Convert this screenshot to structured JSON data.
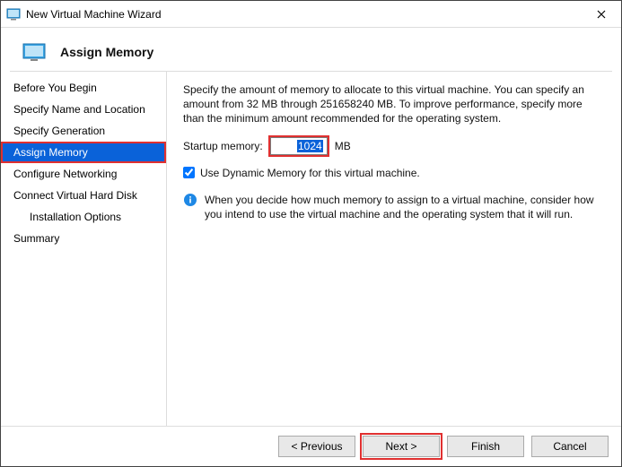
{
  "window": {
    "title": "New Virtual Machine Wizard"
  },
  "header": {
    "heading": "Assign Memory"
  },
  "sidebar": {
    "items": [
      {
        "label": "Before You Begin"
      },
      {
        "label": "Specify Name and Location"
      },
      {
        "label": "Specify Generation"
      },
      {
        "label": "Assign Memory",
        "selected": true,
        "highlight": true
      },
      {
        "label": "Configure Networking"
      },
      {
        "label": "Connect Virtual Hard Disk"
      },
      {
        "label": "Installation Options",
        "indent": true
      },
      {
        "label": "Summary"
      }
    ]
  },
  "content": {
    "description": "Specify the amount of memory to allocate to this virtual machine. You can specify an amount from 32 MB through 251658240 MB. To improve performance, specify more than the minimum amount recommended for the operating system.",
    "memory_label": "Startup memory:",
    "memory_value": "1024",
    "memory_unit": "MB",
    "dynamic_memory_label": "Use Dynamic Memory for this virtual machine.",
    "dynamic_memory_checked": true,
    "info_text": "When you decide how much memory to assign to a virtual machine, consider how you intend to use the virtual machine and the operating system that it will run."
  },
  "footer": {
    "previous": "< Previous",
    "next": "Next >",
    "finish": "Finish",
    "cancel": "Cancel"
  },
  "colors": {
    "accent": "#0a62d9",
    "highlight": "#e03030"
  }
}
